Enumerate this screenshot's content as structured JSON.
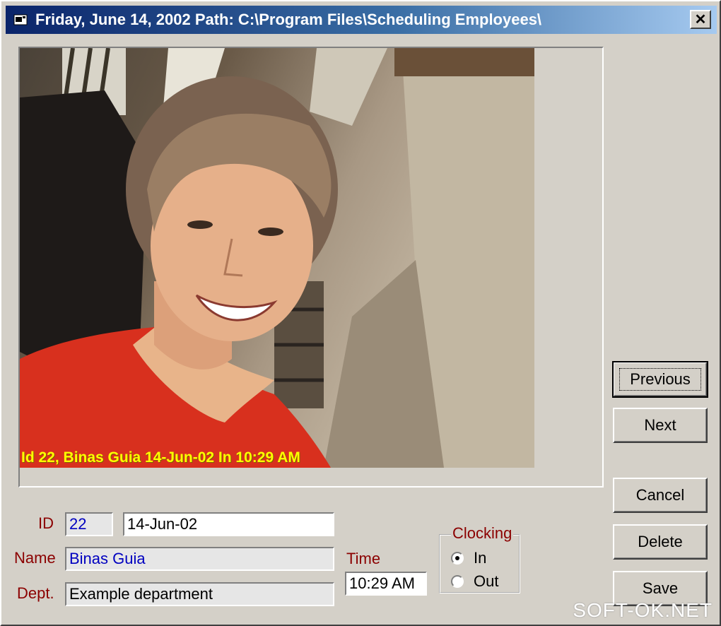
{
  "window": {
    "title": "Friday, June 14, 2002   Path: C:\\Program Files\\Scheduling Employees\\",
    "close_glyph": "✕"
  },
  "photo": {
    "caption": "Id 22, Binas Guia 14-Jun-02  In 10:29 AM"
  },
  "buttons": {
    "previous": "Previous",
    "next": "Next",
    "cancel": "Cancel",
    "delete": "Delete",
    "save": "Save"
  },
  "form": {
    "id_label": "ID",
    "id_value": "22",
    "date_value": "14-Jun-02",
    "name_label": "Name",
    "name_value": "Binas Guia",
    "dept_label": "Dept.",
    "dept_value": "Example department",
    "time_label": "Time",
    "time_value": "10:29 AM"
  },
  "clocking": {
    "title": "Clocking",
    "options": [
      "In",
      "Out"
    ],
    "selected": "In"
  },
  "watermark": "SOFT-OK.NET",
  "colors": {
    "label_text": "#8b0000",
    "field_value_blue": "#0000c0",
    "caption_yellow": "#ffff00",
    "face_background": "#d4d0c8"
  }
}
